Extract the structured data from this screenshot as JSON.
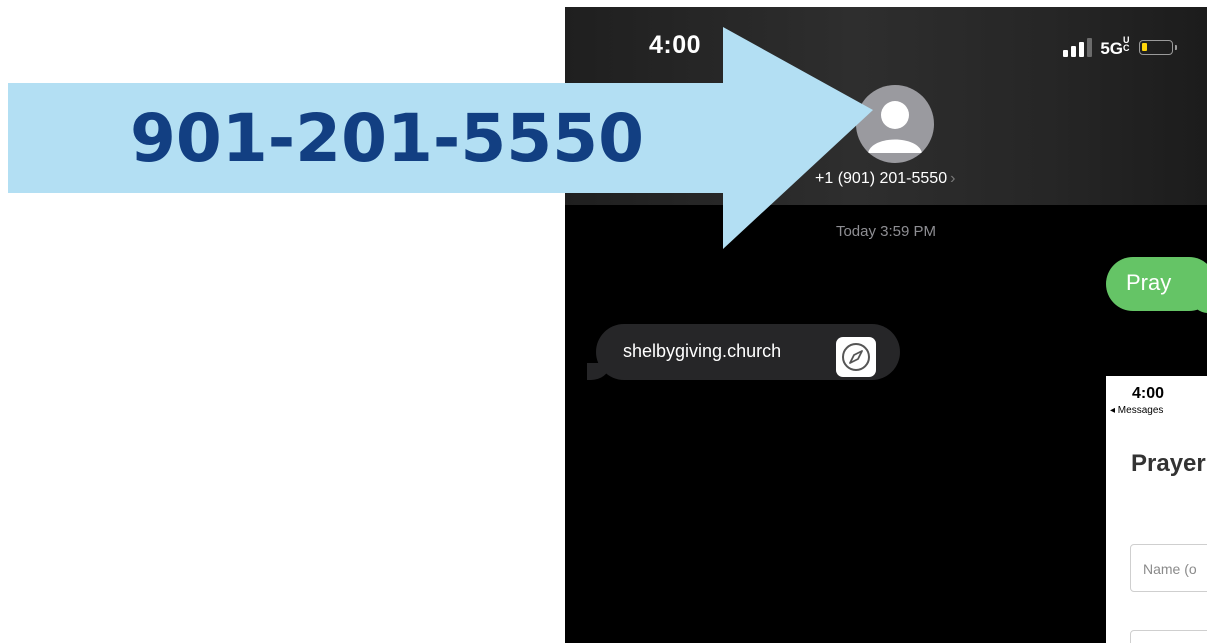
{
  "annotation": {
    "phone_number_label": "901-201-5550",
    "arrow_color": "#b3dff3",
    "label_color": "#123f82"
  },
  "phone": {
    "status_bar": {
      "time": "4:00",
      "network": "5G",
      "network_suffix": "UC",
      "battery_color": "#ffd60a"
    },
    "contact": {
      "number": "+1 (901) 201-5550",
      "chevron": "›"
    },
    "conversation": {
      "timestamp": "Today 3:59 PM",
      "messages": [
        {
          "direction": "sent",
          "text": "Pray",
          "color": "#65c466"
        },
        {
          "direction": "received",
          "text": "shelbygiving.church",
          "icon": "safari-compass-icon"
        }
      ]
    }
  },
  "inset": {
    "time": "4:00",
    "back_label": "◂ Messages",
    "heading": "Prayer",
    "name_placeholder": "Name (o"
  }
}
